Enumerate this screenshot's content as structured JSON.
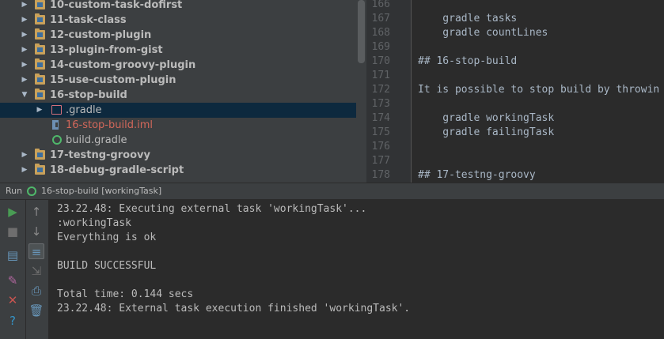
{
  "project_tree": {
    "items": [
      {
        "label": "10-custom-task-dofirst",
        "expanded": false,
        "icon": "module-folder-icon"
      },
      {
        "label": "11-task-class",
        "expanded": false,
        "icon": "module-folder-icon"
      },
      {
        "label": "12-custom-plugin",
        "expanded": false,
        "icon": "module-folder-icon"
      },
      {
        "label": "13-plugin-from-gist",
        "expanded": false,
        "icon": "module-folder-icon"
      },
      {
        "label": "14-custom-groovy-plugin",
        "expanded": false,
        "icon": "module-folder-icon"
      },
      {
        "label": "15-use-custom-plugin",
        "expanded": false,
        "icon": "module-folder-icon"
      },
      {
        "label": "16-stop-build",
        "expanded": true,
        "icon": "module-folder-icon"
      },
      {
        "label": ".gradle",
        "expanded": false,
        "icon": "excluded-folder-icon",
        "selected": true
      },
      {
        "label": "16-stop-build.iml",
        "icon": "iml-file-icon"
      },
      {
        "label": "build.gradle",
        "icon": "gradle-file-icon"
      },
      {
        "label": "17-testng-groovy",
        "expanded": false,
        "icon": "module-folder-icon"
      },
      {
        "label": "18-debug-gradle-script",
        "expanded": false,
        "icon": "module-folder-icon"
      }
    ]
  },
  "editor": {
    "lines": [
      {
        "number": "166",
        "text": ""
      },
      {
        "number": "167",
        "text": "    gradle tasks"
      },
      {
        "number": "168",
        "text": "    gradle countLines"
      },
      {
        "number": "169",
        "text": ""
      },
      {
        "number": "170",
        "text": "## 16-stop-build"
      },
      {
        "number": "171",
        "text": ""
      },
      {
        "number": "172",
        "text": "It is possible to stop build by throwin"
      },
      {
        "number": "173",
        "text": ""
      },
      {
        "number": "174",
        "text": "    gradle workingTask"
      },
      {
        "number": "175",
        "text": "    gradle failingTask"
      },
      {
        "number": "176",
        "text": ""
      },
      {
        "number": "177",
        "text": ""
      },
      {
        "number": "178",
        "text": "## 17-testng-groovy"
      }
    ]
  },
  "run_panel": {
    "label": "Run",
    "title": "16-stop-build [workingTask]",
    "toolbar_left": [
      {
        "icon": "run-icon",
        "color": "#499c54"
      },
      {
        "icon": "stop-icon",
        "color": "#6e6e6e"
      },
      {
        "icon": "layout-icon",
        "color": "#6897bb"
      },
      {
        "icon": "pin-icon",
        "color": "#b0669e"
      },
      {
        "icon": "close-icon",
        "color": "#c75450"
      },
      {
        "icon": "help-icon",
        "color": "#3592c4"
      }
    ],
    "toolbar_right": [
      {
        "icon": "arrow-up-icon",
        "color": "#8a8a8a"
      },
      {
        "icon": "arrow-down-icon",
        "color": "#8a8a8a"
      },
      {
        "icon": "soft-wrap-icon",
        "color": "#6897bb",
        "pressed": true
      },
      {
        "icon": "scroll-to-end-icon",
        "color": "#6e6e6e"
      },
      {
        "icon": "print-icon",
        "color": "#6897bb"
      },
      {
        "icon": "trash-icon",
        "color": "#6897bb"
      }
    ],
    "console_lines": [
      "23.22.48: Executing external task 'workingTask'...",
      ":workingTask",
      "Everything is ok",
      "",
      "BUILD SUCCESSFUL",
      "",
      "Total time: 0.144 secs",
      "23.22.48: External task execution finished 'workingTask'."
    ]
  },
  "colors": {
    "tree_bg": "#3c3f41",
    "editor_bg": "#2b2b2b",
    "selection_bg": "#0d293e",
    "folder": "#c9a15a",
    "text": "#a9b7c6",
    "iml_text": "#d1675a"
  }
}
